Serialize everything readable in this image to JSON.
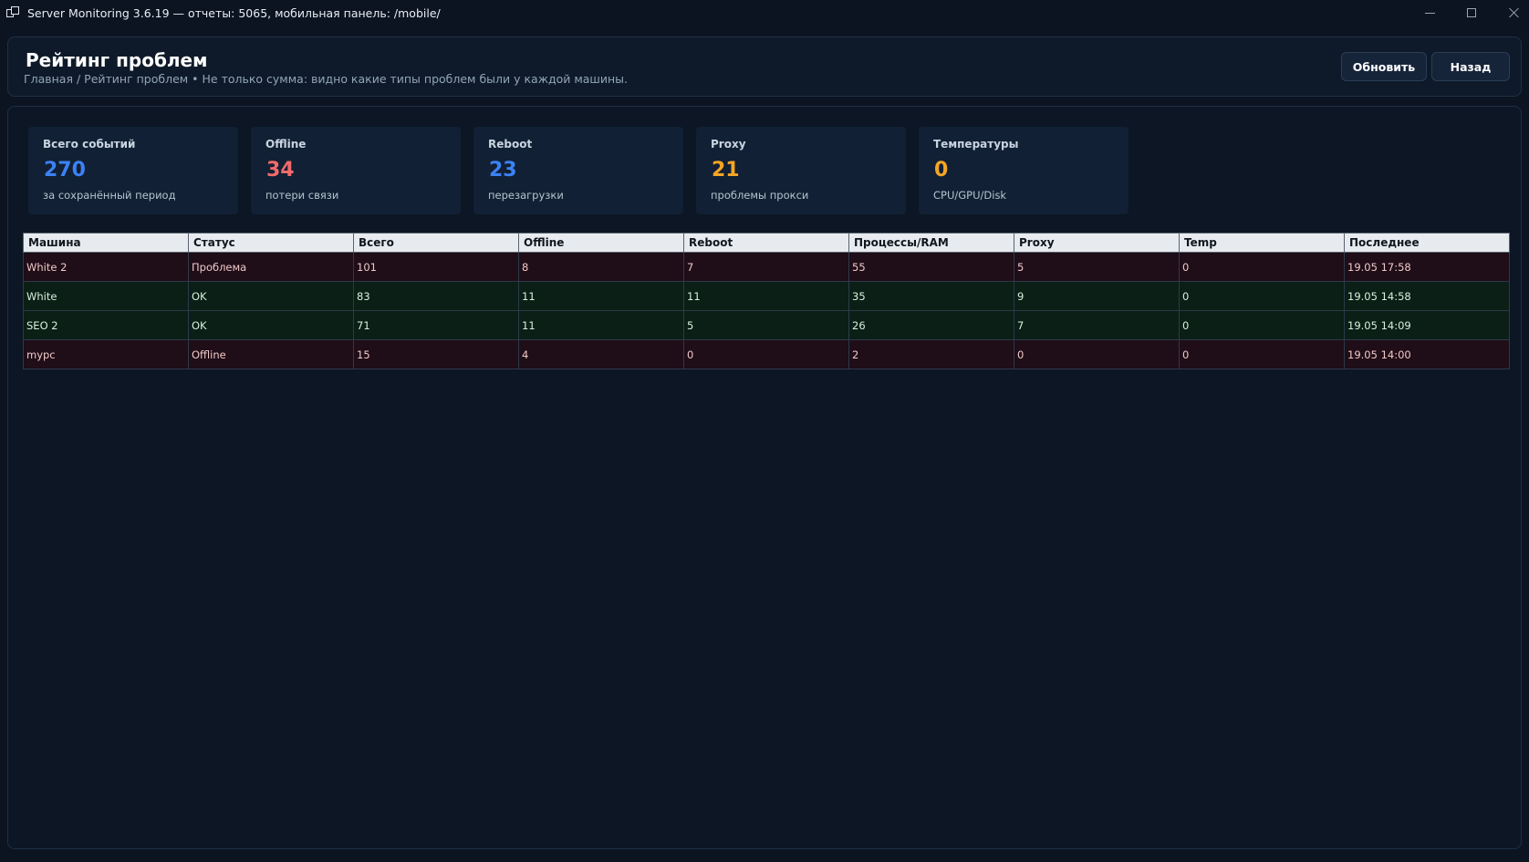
{
  "window": {
    "title": "Server Monitoring 3.6.19 — отчеты: 5065, мобильная панель: /mobile/"
  },
  "header": {
    "title": "Рейтинг проблем",
    "breadcrumb": "Главная / Рейтинг проблем  •  Не только сумма: видно какие типы проблем были у каждой машины.",
    "refresh_label": "Обновить",
    "back_label": "Назад"
  },
  "cards": [
    {
      "label": "Всего событий",
      "value": "270",
      "sub": "за сохранённый период",
      "color": "#3b82f6"
    },
    {
      "label": "Offline",
      "value": "34",
      "sub": "потери связи",
      "color": "#f26a6a"
    },
    {
      "label": "Reboot",
      "value": "23",
      "sub": "перезагрузки",
      "color": "#3b82f6"
    },
    {
      "label": "Proxy",
      "value": "21",
      "sub": "проблемы прокси",
      "color": "#f5a524"
    },
    {
      "label": "Температуры",
      "value": "0",
      "sub": "CPU/GPU/Disk",
      "color": "#f5a524"
    }
  ],
  "table": {
    "columns": [
      "Машина",
      "Статус",
      "Всего",
      "Offline",
      "Reboot",
      "Процессы/RAM",
      "Proxy",
      "Temp",
      "Последнее"
    ],
    "rows": [
      {
        "state": "bad",
        "cells": [
          "White 2",
          "Проблема",
          "101",
          "8",
          "7",
          "55",
          "5",
          "0",
          "19.05 17:58"
        ]
      },
      {
        "state": "ok",
        "cells": [
          "White",
          "OK",
          "83",
          "11",
          "11",
          "35",
          "9",
          "0",
          "19.05 14:58"
        ]
      },
      {
        "state": "ok",
        "cells": [
          "SEO 2",
          "OK",
          "71",
          "11",
          "5",
          "26",
          "7",
          "0",
          "19.05 14:09"
        ]
      },
      {
        "state": "bad",
        "cells": [
          "mypc",
          "Offline",
          "15",
          "4",
          "0",
          "2",
          "0",
          "0",
          "19.05 14:00"
        ]
      }
    ]
  }
}
